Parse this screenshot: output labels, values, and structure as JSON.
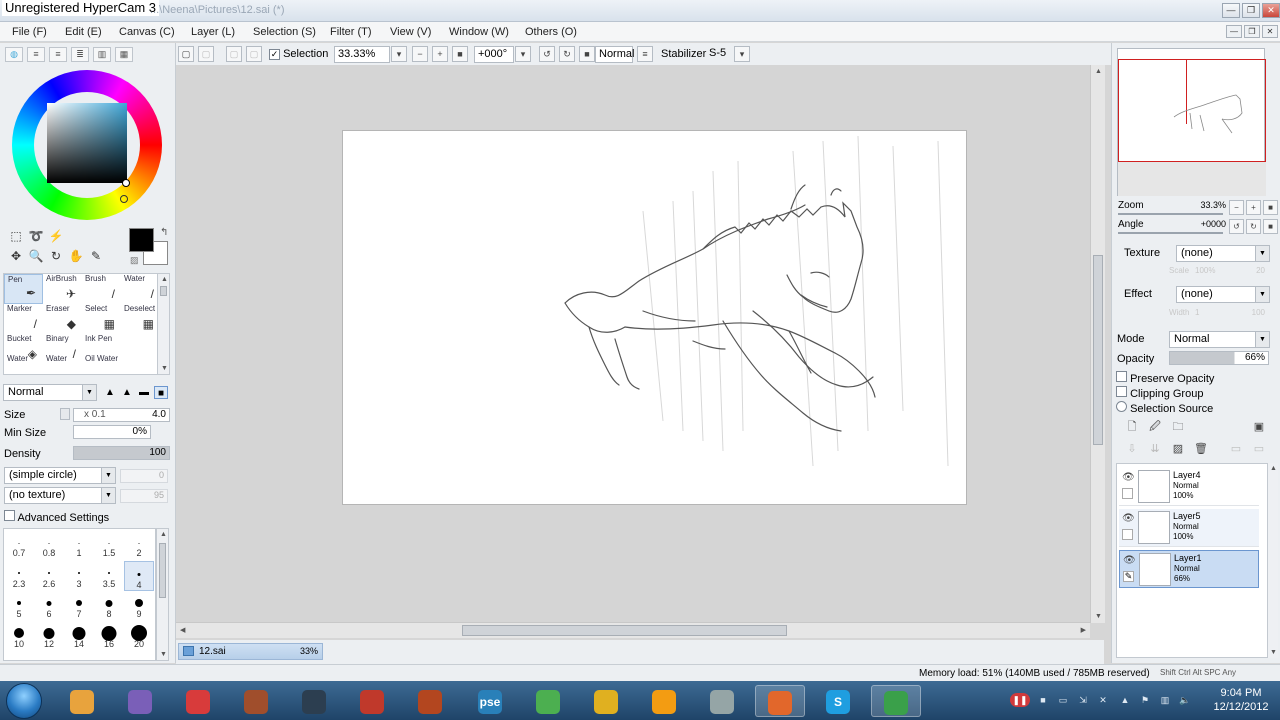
{
  "window": {
    "watermark": "Unregistered HyperCam 3",
    "path": "...\\Neena\\Pictures\\12.sai (*)",
    "buttons": [
      "—",
      "❐",
      "✕"
    ],
    "mdi_buttons": [
      "—",
      "❐",
      "✕"
    ]
  },
  "menu": [
    "File (F)",
    "Edit (E)",
    "Canvas (C)",
    "Layer (L)",
    "Selection (S)",
    "Filter (T)",
    "View (V)",
    "Window (W)",
    "Others (O)"
  ],
  "toolbar": {
    "selection_label": "Selection",
    "selection_checked": "✓",
    "zoom": "33.33%",
    "angle": "+000°",
    "blend": "Normal",
    "stabilizer_label": "Stabilizer",
    "stabilizer": "S-5"
  },
  "left_panel": {
    "accent_color": "#3fa7d8",
    "tools": [
      {
        "label": "Pen",
        "icon": "✒"
      },
      {
        "label": "AirBrush",
        "icon": "✈"
      },
      {
        "label": "Brush",
        "icon": "/"
      },
      {
        "label": "Water",
        "icon": "/"
      },
      {
        "label": "Marker",
        "icon": "/"
      },
      {
        "label": "Eraser",
        "icon": "◆"
      },
      {
        "label": "Select",
        "icon": "▦"
      },
      {
        "label": "Deselect",
        "icon": "▦"
      },
      {
        "label": "Bucket",
        "icon": "◈"
      },
      {
        "label": "Binary",
        "icon": "/"
      },
      {
        "label": "Ink Pen",
        "icon": ""
      },
      {
        "label": "",
        "icon": ""
      },
      {
        "label": "Water",
        "icon": ""
      },
      {
        "label": "Water",
        "icon": ""
      },
      {
        "label": "Oil Water",
        "icon": ""
      },
      {
        "label": "",
        "icon": ""
      }
    ],
    "blend_mode": "Normal",
    "size_label": "Size",
    "size_multiplier": "x 0.1",
    "size_value": "4.0",
    "min_size_label": "Min Size",
    "min_size_value": "0%",
    "density_label": "Density",
    "density_value": "100",
    "brush_shape": "(simple circle)",
    "brush_shape_value": "0",
    "brush_texture": "(no texture)",
    "brush_texture_value": "95",
    "advanced_settings": "Advanced Settings",
    "brush_sizes": [
      {
        "label": "0.7",
        "d": 1
      },
      {
        "label": "0.8",
        "d": 1
      },
      {
        "label": "1",
        "d": 1
      },
      {
        "label": "1.5",
        "d": 1
      },
      {
        "label": "2",
        "d": 1
      },
      {
        "label": "2.3",
        "d": 2
      },
      {
        "label": "2.6",
        "d": 2
      },
      {
        "label": "3",
        "d": 2
      },
      {
        "label": "3.5",
        "d": 2
      },
      {
        "label": "4",
        "d": 3
      },
      {
        "label": "5",
        "d": 4
      },
      {
        "label": "6",
        "d": 5
      },
      {
        "label": "7",
        "d": 6
      },
      {
        "label": "8",
        "d": 7
      },
      {
        "label": "9",
        "d": 8
      },
      {
        "label": "10",
        "d": 10
      },
      {
        "label": "12",
        "d": 11
      },
      {
        "label": "14",
        "d": 13
      },
      {
        "label": "16",
        "d": 15
      },
      {
        "label": "20",
        "d": 17
      }
    ],
    "selected_brush": "4"
  },
  "canvas": {
    "doc_tab": "12.sai",
    "doc_zoom": "33%"
  },
  "right_panel": {
    "zoom_label": "Zoom",
    "zoom_value": "33.3%",
    "angle_label": "Angle",
    "angle_value": "+0000",
    "texture_label": "Texture",
    "texture_value": "(none)",
    "texture_scale": "Scale",
    "texture_scale_value": "100%",
    "texture_scale_value2": "20",
    "effect_label": "Effect",
    "effect_value": "(none)",
    "effect_width": "Width",
    "effect_width_value": "1",
    "effect_width_value2": "100",
    "mode_label": "Mode",
    "mode_value": "Normal",
    "opacity_label": "Opacity",
    "opacity_value": "66%",
    "preserve_opacity": "Preserve Opacity",
    "clipping_group": "Clipping Group",
    "selection_source": "Selection Source",
    "layers": [
      {
        "name": "Layer4",
        "mode": "Normal",
        "opacity": "100%",
        "visible": "👁",
        "state": ""
      },
      {
        "name": "Layer5",
        "mode": "Normal",
        "opacity": "100%",
        "visible": "👁",
        "state": "hover"
      },
      {
        "name": "Layer1",
        "mode": "Normal",
        "opacity": "66%",
        "visible": "👁",
        "state": "selected"
      }
    ]
  },
  "status": {
    "memory": "Memory load: 51% (140MB used / 785MB reserved)",
    "keys": "Shift Ctrl Alt SPC Any"
  },
  "taskbar": {
    "apps": [
      {
        "name": "explorer-app",
        "label": "",
        "color": "#e8a33d"
      },
      {
        "name": "messenger-app",
        "label": "",
        "color": "#7a5fb8"
      },
      {
        "name": "media-app",
        "label": "",
        "color": "#d83b3b"
      },
      {
        "name": "paint-app",
        "label": "",
        "color": "#a04e2c"
      },
      {
        "name": "steam-app",
        "label": "",
        "color": "#2c3e50"
      },
      {
        "name": "uploader-app",
        "label": "",
        "color": "#c0392b"
      },
      {
        "name": "archive-app",
        "label": "",
        "color": "#b3461f"
      },
      {
        "name": "pse-app",
        "label": "pse",
        "color": "#2980b9"
      },
      {
        "name": "play-app",
        "label": "",
        "color": "#4caf50"
      },
      {
        "name": "chrome-app",
        "label": "",
        "color": "#e0b020"
      },
      {
        "name": "vlc-app",
        "label": "",
        "color": "#f39c12"
      },
      {
        "name": "notepad-app",
        "label": "",
        "color": "#95a5a6"
      },
      {
        "name": "firefox-app",
        "label": "",
        "color": "#e2672b"
      },
      {
        "name": "skype-app",
        "label": "S",
        "color": "#1f9ee0"
      },
      {
        "name": "sai-app",
        "label": "",
        "color": "#3aa04a"
      }
    ],
    "time": "9:04 PM",
    "date": "12/12/2012"
  }
}
